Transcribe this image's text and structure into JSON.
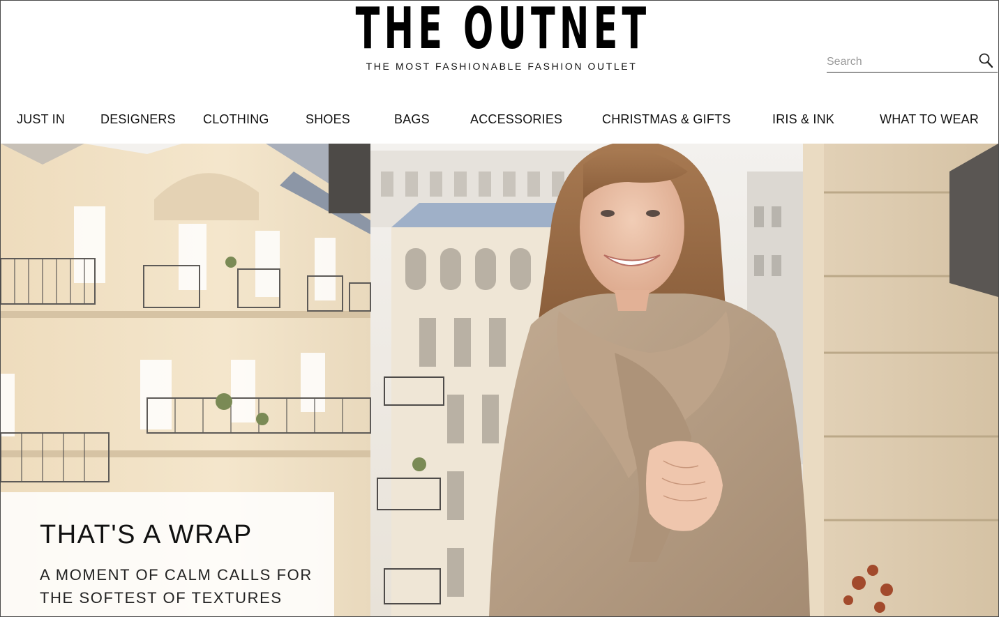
{
  "header": {
    "logo_text": "THE OUTNET",
    "tagline": "THE MOST FASHIONABLE FASHION OUTLET",
    "search": {
      "placeholder": "Search",
      "icon": "search-icon"
    }
  },
  "nav": {
    "items": [
      {
        "label": "JUST IN"
      },
      {
        "label": "DESIGNERS"
      },
      {
        "label": "CLOTHING"
      },
      {
        "label": "SHOES"
      },
      {
        "label": "BAGS"
      },
      {
        "label": "ACCESSORIES"
      },
      {
        "label": "CHRISTMAS & GIFTS"
      },
      {
        "label": "IRIS & INK"
      },
      {
        "label": "WHAT TO WEAR"
      }
    ]
  },
  "hero": {
    "title": "THAT'S A WRAP",
    "subtitle": "A MOMENT OF CALM CALLS FOR THE SOFTEST OF TEXTURES"
  },
  "colors": {
    "text": "#111111",
    "border": "#4a4a4a",
    "coat": "#b79f86",
    "building": "#e6d6bd"
  }
}
